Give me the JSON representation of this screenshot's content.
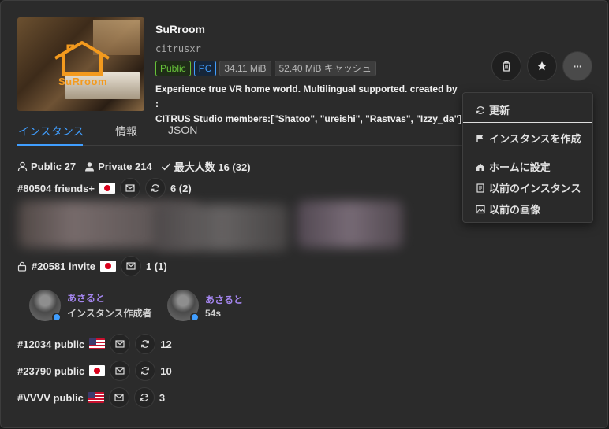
{
  "world": {
    "name": "SuRroom",
    "author": "citrusxr",
    "logo_text": "SuRroom",
    "tags": {
      "release": "Public",
      "platform": "PC",
      "size": "34.11 MiB",
      "cache": "52.40 MiB キャッシュ"
    },
    "description_1": "Experience true VR home world. Multilingual supported. created by :",
    "description_2": "CITRUS Studio members:[\"Shatoo\", \"ureishi\", \"Rastvas\", \"Izzy_da\"]"
  },
  "actions": {
    "delete_icon": "trash-icon",
    "favorite_icon": "star-icon",
    "more_icon": "ellipsis-icon",
    "more_glyph": "···"
  },
  "tabs": [
    {
      "label": "インスタンス"
    },
    {
      "label": "情報"
    },
    {
      "label": "JSON"
    }
  ],
  "stats": {
    "public": "Public 27",
    "private": "Private 214",
    "max": "最大人数 16 (32)"
  },
  "instances": [
    {
      "id": "#80504 friends+",
      "region": "jp",
      "count": "6 (2)"
    },
    {
      "id": "#20581 invite",
      "region": "jp",
      "count": "1 (1)",
      "locked": true
    },
    {
      "id": "#12034 public",
      "region": "us",
      "count": "12"
    },
    {
      "id": "#23790 public",
      "region": "jp",
      "count": "10"
    },
    {
      "id": "#VVVV public",
      "region": "us",
      "count": "3"
    }
  ],
  "users": [
    {
      "name": "あさると",
      "sub": "インスタンス作成者"
    },
    {
      "name": "あさると",
      "sub": "54s"
    }
  ],
  "menu": {
    "refresh": "更新",
    "create_instance": "インスタンスを作成",
    "set_home": "ホームに設定",
    "previous_instances": "以前のインスタンス",
    "previous_images": "以前の画像"
  },
  "colors": {
    "accent": "#409eff",
    "public_tag": "#67c23a",
    "username": "#a586f0",
    "background": "#2b2b2b"
  }
}
